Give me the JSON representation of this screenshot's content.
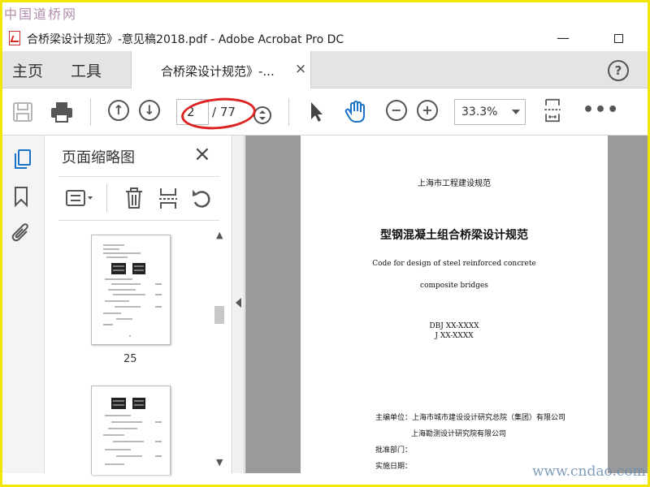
{
  "watermark": {
    "top": "中国道桥网",
    "bottom": "www.cndao.com"
  },
  "window": {
    "title": "合桥梁设计规范》-意见稿2018.pdf - Adobe Acrobat Pro DC",
    "minimize_label": "—"
  },
  "menu": {
    "home_label": "主页",
    "tools_label": "工具",
    "tab_label": "合桥梁设计规范》-...",
    "tab_close": "×",
    "help_label": "?"
  },
  "toolbar": {
    "page_current": "2",
    "page_total": "/ 77",
    "zoom_value": "33.3%",
    "prev_label": "↑",
    "next_label": "↓",
    "zoom_out_label": "−",
    "zoom_in_label": "+",
    "more_label": "•••"
  },
  "thumbnail_panel": {
    "title": "页面缩略图",
    "close_label": "×",
    "thumbnails": [
      {
        "label": "25"
      },
      {
        "label": ""
      }
    ]
  },
  "document": {
    "series": "上海市工程建设规范",
    "title": "型钢混凝土组合桥梁设计规范",
    "english_line1": "Code for design of steel reinforced concrete",
    "english_line2": "composite bridges",
    "code1": "DBJ XX-XXXX",
    "code2": "J XX-XXXX",
    "editor1": "主编单位：上海市城市建设设计研究总院（集团）有限公司",
    "editor2": "上海勘测设计研究院有限公司",
    "approve": "批准部门：",
    "date": "实施日期："
  },
  "colors": {
    "frame_border": "#f2e600",
    "accent_blue": "#1a73c8",
    "highlight_red": "#d22222",
    "doc_background": "#9a9a9a"
  }
}
